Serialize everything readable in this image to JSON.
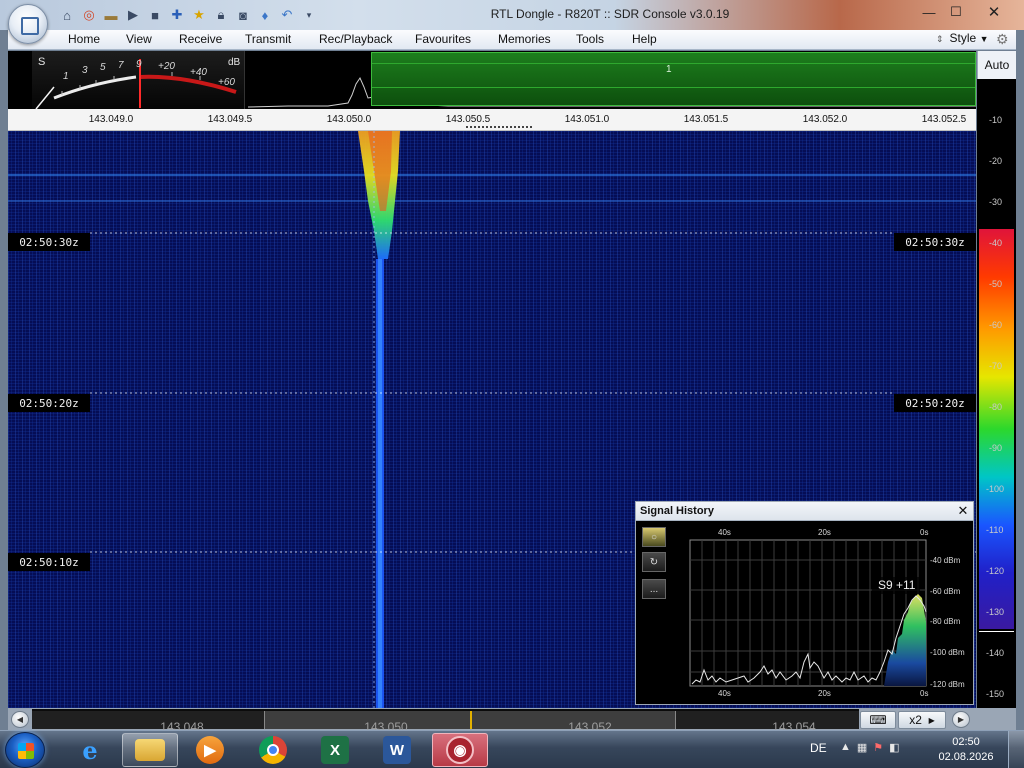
{
  "window": {
    "title": "RTL Dongle - R820T :: SDR Console v3.0.19",
    "controls": {
      "minimize": "—",
      "maximize": "☐",
      "close": "✕"
    }
  },
  "quick_access": [
    "home-icon",
    "lifebuoy-icon",
    "folder-icon",
    "play-icon",
    "stop-icon",
    "plus-icon",
    "star-icon",
    "lock-icon",
    "camera-icon",
    "drop-icon",
    "undo-icon",
    "dropdown-icon"
  ],
  "menu": {
    "tabs": [
      "Home",
      "View",
      "Receive",
      "Transmit",
      "Rec/Playback",
      "Favourites",
      "Memories",
      "Tools",
      "Help"
    ],
    "style_label": "Style"
  },
  "smeter": {
    "s_label": "S",
    "db_label": "dB",
    "s_scale": [
      "1",
      "3",
      "5",
      "7",
      "9"
    ],
    "plus_scale": [
      "+20",
      "+40",
      "+60"
    ]
  },
  "spectrum": {
    "vfo_label": "1",
    "auto_label": "Auto"
  },
  "frequency_scale": [
    "143.049.0",
    "143.049.5",
    "143.050.0",
    "143.050.5",
    "143.051.0",
    "143.051.5",
    "143.052.0",
    "143.052.5"
  ],
  "waterfall": {
    "timestamps": [
      "02:50:30z",
      "02:50:20z",
      "02:50:10z"
    ]
  },
  "db_scale": [
    "-10",
    "-20",
    "-30",
    "-40",
    "-50",
    "-60",
    "-70",
    "-80",
    "-90",
    "-100",
    "-110",
    "-120",
    "-130",
    "-140",
    "-150"
  ],
  "bottom_bar": {
    "labels": [
      "143.048",
      "143.050",
      "143.052",
      "143.054"
    ],
    "zoom": "x2"
  },
  "signal_history": {
    "title": "Signal History",
    "close": "✕",
    "reading": "S9 +11",
    "time_labels": [
      "40s",
      "20s",
      "0s"
    ],
    "level_labels": [
      "-40 dBm",
      "-60 dBm",
      "-80 dBm",
      "-100 dBm",
      "-120 dBm"
    ],
    "buttons": [
      "○",
      "↻",
      "..."
    ]
  },
  "taskbar": {
    "apps": [
      "internet-explorer-icon",
      "file-explorer-icon",
      "media-player-icon",
      "chrome-icon",
      "excel-icon",
      "word-icon",
      "sdr-console-icon"
    ],
    "language": "DE",
    "time": "02:50",
    "date": "02.08.2026"
  },
  "colors": {
    "waterfall_bg": "#050d55",
    "signal_core": "#f0a020",
    "accent_green": "#1d7e1d",
    "taskbar": "#37465b"
  }
}
